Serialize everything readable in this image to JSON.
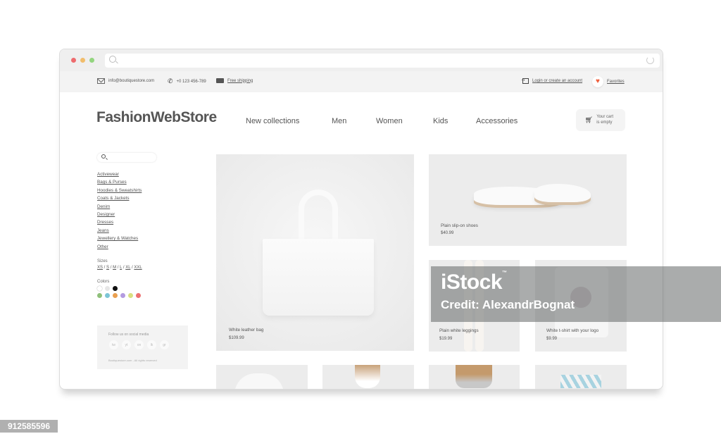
{
  "browser": {
    "window_controls": [
      "close",
      "minimize",
      "maximize"
    ],
    "url_value": ""
  },
  "infobar": {
    "email": "info@boutiquestore.com",
    "phone": "+0 123 456-789",
    "shipping": "Free shipping",
    "login": "Login or create an account",
    "favorites": "Favorites"
  },
  "header": {
    "logo": "FashionWebStore",
    "nav": [
      "New collections",
      "Men",
      "Women",
      "Kids",
      "Accessories"
    ],
    "cart_line1": "Your cart",
    "cart_line2": "is empty"
  },
  "sidebar": {
    "search_placeholder": "",
    "categories": [
      "Activewear",
      "Bags & Purses",
      "Hoodies & Sweatshirts",
      "Coats & Jackets",
      "Denim",
      "Designer",
      "Dresses",
      "Jeans",
      "Jewellery & Watches",
      "Other"
    ],
    "sizes_label": "Sizes",
    "sizes": [
      "XS",
      "S",
      "M",
      "L",
      "XL",
      "XXL"
    ],
    "colors_label": "Colors",
    "colors_row1": [
      "#ffffff",
      "#e6e6e6",
      "#111111"
    ],
    "colors_row2": [
      "#8fc07a",
      "#7cc5d6",
      "#eaa050",
      "#b39be0",
      "#d9e080",
      "#ec7070"
    ],
    "social_title": "Follow us on social media",
    "social": [
      "tw",
      "yt",
      "on",
      "lk",
      "gr"
    ],
    "copyright": "Boutiquestore.com - All rights reserved"
  },
  "products": [
    {
      "name": "White leather bag",
      "price": "$109.99"
    },
    {
      "name": "Plain slip-on shoes",
      "price": "$40.99"
    },
    {
      "name": "Plain white leggings",
      "price": "$19.99"
    },
    {
      "name": "White t-shirt with your logo",
      "price": "$9.99"
    }
  ],
  "watermark": {
    "brand": "iStock",
    "tm": "™",
    "credit": "Credit: AlexandrBognat"
  },
  "stock_id": "912585596",
  "colors": {
    "favorite_heart": "#ef5f3c",
    "card_bg": "#ececec",
    "infobar_bg": "#f3f3f3"
  }
}
